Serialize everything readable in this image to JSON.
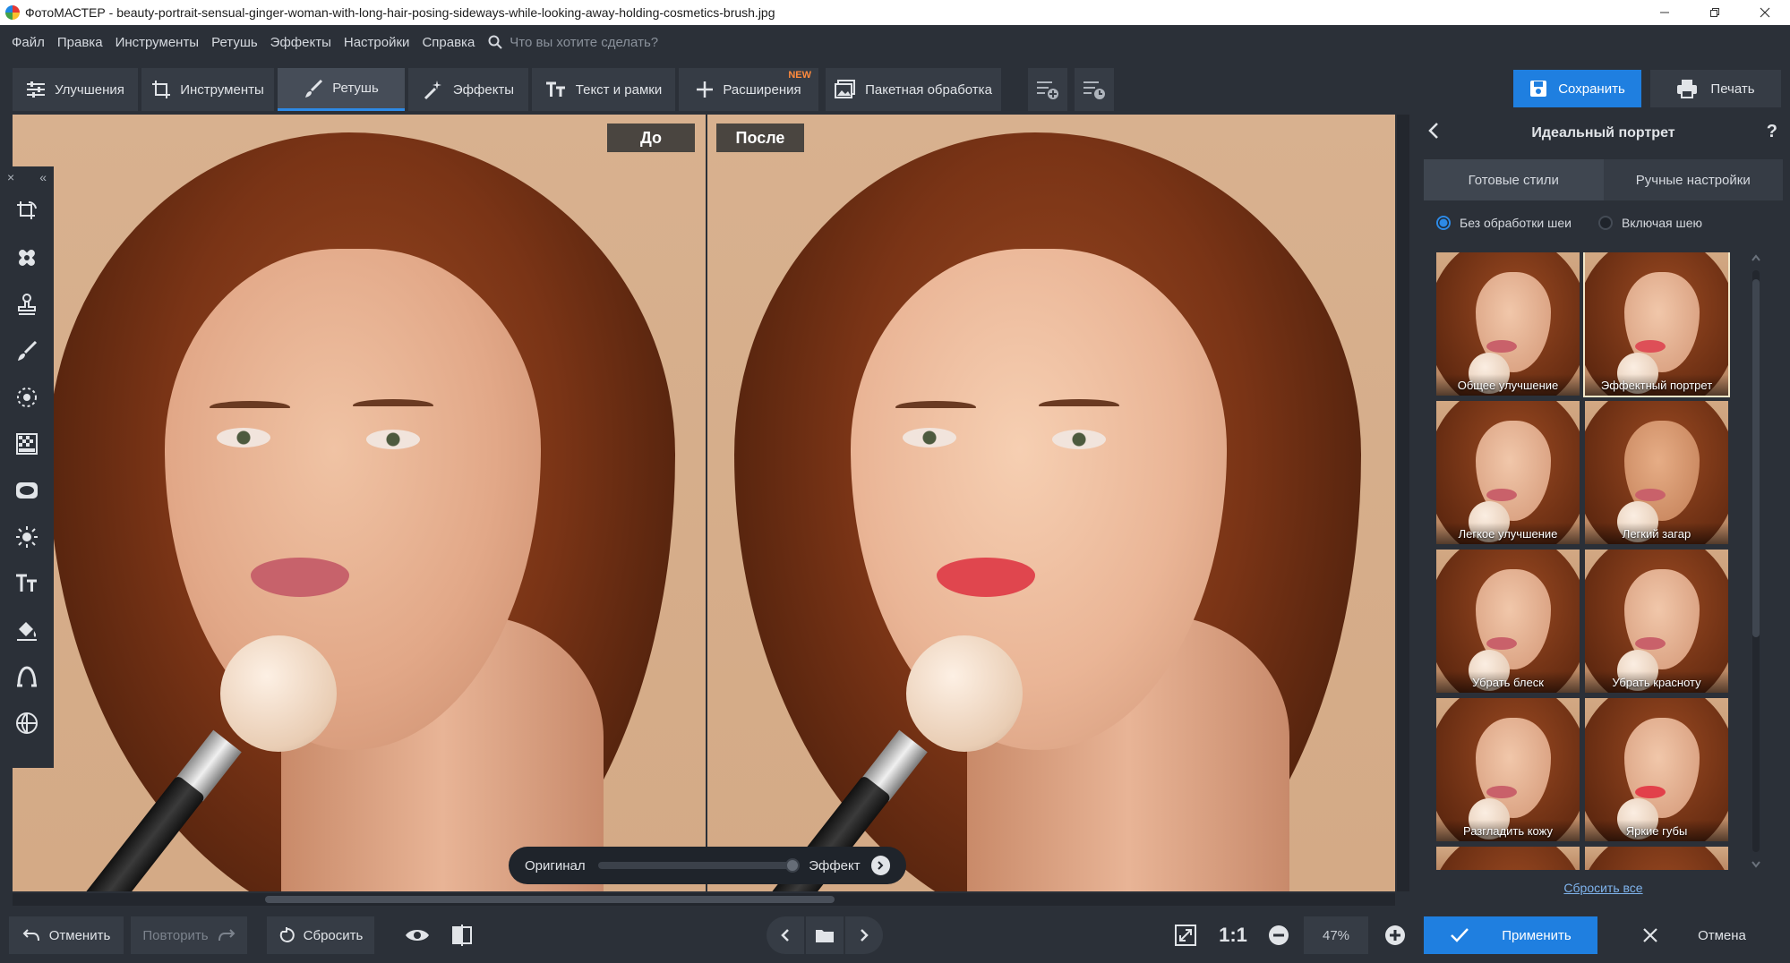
{
  "window": {
    "app_name": "ФотоМАСТЕР",
    "file_name": "beauty-portrait-sensual-ginger-woman-with-long-hair-posing-sideways-while-looking-away-holding-cosmetics-brush.jpg",
    "separator": " - "
  },
  "menu": {
    "items": [
      "Файл",
      "Правка",
      "Инструменты",
      "Ретушь",
      "Эффекты",
      "Настройки",
      "Справка"
    ],
    "search_placeholder": "Что вы хотите сделать?"
  },
  "toolbar": {
    "tabs": [
      {
        "label": "Улучшения",
        "icon": "sliders-icon"
      },
      {
        "label": "Инструменты",
        "icon": "crop-icon"
      },
      {
        "label": "Ретушь",
        "icon": "brush-icon",
        "active": true
      },
      {
        "label": "Эффекты",
        "icon": "magic-wand-icon"
      },
      {
        "label": "Текст и рамки",
        "icon": "text-icon"
      },
      {
        "label": "Расширения",
        "icon": "plus-icon",
        "badge": "NEW"
      },
      {
        "label": "Пакетная обработка",
        "icon": "batch-images-icon"
      }
    ],
    "save_label": "Сохранить",
    "print_label": "Печать"
  },
  "canvas": {
    "before_label": "До",
    "after_label": "После"
  },
  "compare": {
    "original_label": "Оригинал",
    "effect_label": "Эффект",
    "effect_strength": 1.0
  },
  "panel": {
    "title": "Идеальный портрет",
    "help": "?",
    "tabs": [
      "Готовые стили",
      "Ручные настройки"
    ],
    "active_tab": "Готовые стили",
    "radio_options": [
      "Без обработки шеи",
      "Включая шею"
    ],
    "radio_selected": "Без обработки шеи",
    "presets": [
      {
        "label": "Общее улучшение",
        "selected": false
      },
      {
        "label": "Эффектный портрет",
        "selected": true
      },
      {
        "label": "Легкое улучшение",
        "selected": false
      },
      {
        "label": "Легкий загар",
        "selected": false
      },
      {
        "label": "Убрать блеск",
        "selected": false
      },
      {
        "label": "Убрать красноту",
        "selected": false
      },
      {
        "label": "Разгладить кожу",
        "selected": false
      },
      {
        "label": "Яркие губы",
        "selected": false
      }
    ],
    "reset_all": "Сбросить все"
  },
  "bottom": {
    "undo_label": "Отменить",
    "redo_label": "Повторить",
    "reset_label": "Сбросить",
    "zoom_1to1": "1:1",
    "zoom_value": "47%",
    "apply_label": "Применить",
    "cancel_label": "Отмена"
  },
  "colors": {
    "accent": "#1f7fe0",
    "background": "#2b3038",
    "badge_new": "#ff8a3d"
  }
}
